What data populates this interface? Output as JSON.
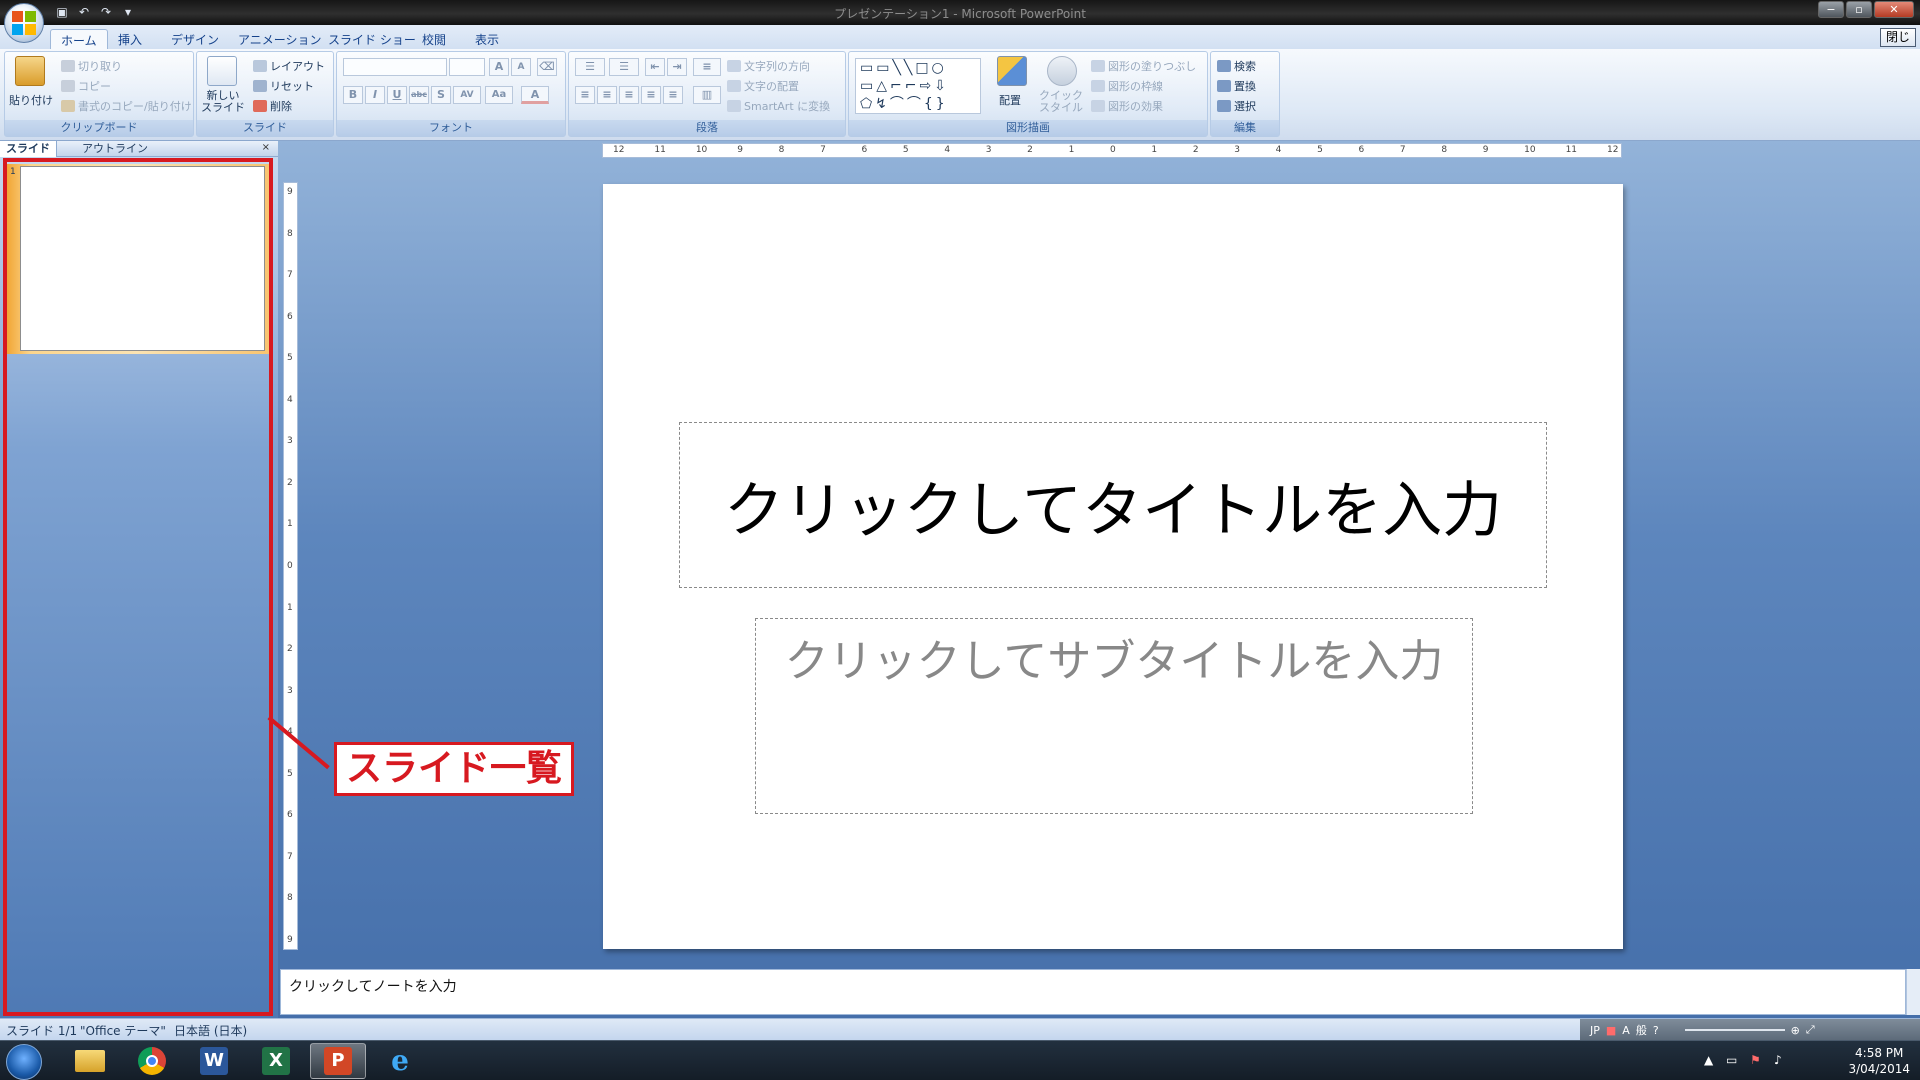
{
  "app": {
    "window_title": "プレゼンテーション1 - Microsoft PowerPoint",
    "close_tooltip": "閉じる"
  },
  "ribbon_tabs": [
    "ホーム",
    "挿入",
    "デザイン",
    "アニメーション",
    "スライド ショー",
    "校閲",
    "表示"
  ],
  "ribbon": {
    "clipboard": {
      "label": "クリップボード",
      "paste": "貼り付け",
      "cut": "切り取り",
      "copy": "コピー",
      "format_painter": "書式のコピー/貼り付け"
    },
    "slides": {
      "label": "スライド",
      "new_slide": "新しい スライド",
      "layout": "レイアウト",
      "reset": "リセット",
      "delete": "削除"
    },
    "font": {
      "label": "フォント",
      "bold": "B",
      "italic": "I",
      "underline": "U",
      "strike": "abc",
      "shadow": "S",
      "spacing": "AV",
      "case": "Aa",
      "grow": "A",
      "color": "A"
    },
    "paragraph": {
      "label": "段落",
      "text_direction": "文字列の方向",
      "align_text": "文字の配置",
      "smartart": "SmartArt に変換"
    },
    "drawing": {
      "label": "図形描画",
      "arrange": "配置",
      "quick_styles": "クイック スタイル",
      "fill": "図形の塗りつぶし",
      "outline": "図形の枠線",
      "effects": "図形の効果"
    },
    "editing": {
      "label": "編集",
      "find": "検索",
      "replace": "置換",
      "select": "選択"
    }
  },
  "slide_panel": {
    "tabs": [
      "スライド",
      "アウトライン"
    ],
    "close_icon": "×",
    "thumbnail_number": "1"
  },
  "annotation": {
    "label": "スライド一覧",
    "color": "#d71920"
  },
  "ruler": {
    "horizontal": [
      "12",
      "11",
      "10",
      "9",
      "8",
      "7",
      "6",
      "5",
      "4",
      "3",
      "2",
      "1",
      "0",
      "1",
      "2",
      "3",
      "4",
      "5",
      "6",
      "7",
      "8",
      "9",
      "10",
      "11",
      "12"
    ],
    "vertical": [
      "9",
      "8",
      "7",
      "6",
      "5",
      "4",
      "3",
      "2",
      "1",
      "0",
      "1",
      "2",
      "3",
      "4",
      "5",
      "6",
      "7",
      "8",
      "9"
    ]
  },
  "slide": {
    "title_placeholder": "クリックしてタイトルを入力",
    "subtitle_placeholder": "クリックしてサブタイトルを入力"
  },
  "notes": {
    "placeholder": "クリックしてノートを入力"
  },
  "status_bar": {
    "slide_count": "スライド 1/1",
    "theme": "\"Office テーマ\"",
    "language": "日本語 (日本)",
    "ime": "JP"
  },
  "taskbar": {
    "apps": [
      "explorer-icon",
      "chrome-icon",
      "word-icon",
      "excel-icon",
      "powerpoint-icon",
      "ie-icon"
    ],
    "time": "4:58 PM",
    "date": "3/04/2014"
  }
}
